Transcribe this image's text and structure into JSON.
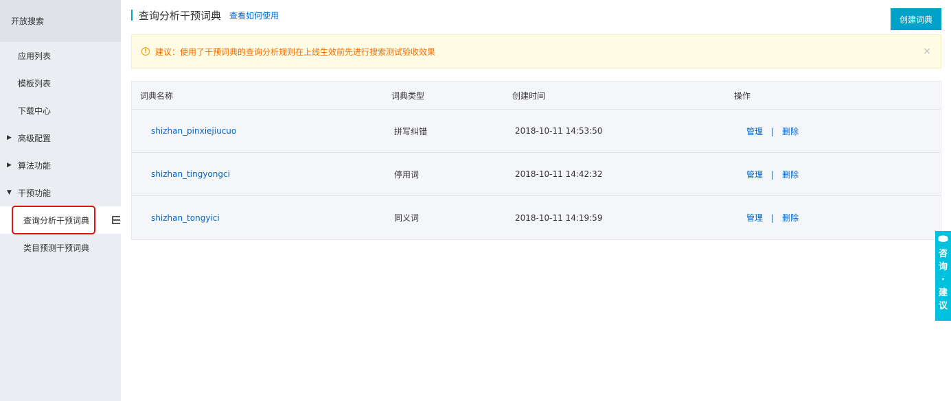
{
  "sidebar": {
    "title": "开放搜索",
    "items": [
      {
        "label": "应用列表",
        "type": "item"
      },
      {
        "label": "模板列表",
        "type": "item"
      },
      {
        "label": "下载中心",
        "type": "item"
      },
      {
        "label": "高级配置",
        "type": "group",
        "expanded": false
      },
      {
        "label": "算法功能",
        "type": "group",
        "expanded": false
      },
      {
        "label": "干预功能",
        "type": "group",
        "expanded": true
      },
      {
        "label": "查询分析干预词典",
        "type": "sub",
        "active": true
      },
      {
        "label": "类目预测干预词典",
        "type": "sub"
      }
    ]
  },
  "header": {
    "title": "查询分析干预词典",
    "help_link": "查看如何使用",
    "create_button": "创建词典"
  },
  "alert": {
    "text": "建议：使用了干预词典的查询分析规则在上线生效前先进行搜索测试验收效果",
    "close": "×"
  },
  "table": {
    "columns": [
      "词典名称",
      "词典类型",
      "创建时间",
      "操作"
    ],
    "rows": [
      {
        "name": "shizhan_pinxiejiucuo",
        "type": "拼写纠错",
        "created": "2018-10-11 14:53:50",
        "manage": "管理",
        "delete": "删除"
      },
      {
        "name": "shizhan_tingyongci",
        "type": "停用词",
        "created": "2018-10-11 14:42:32",
        "manage": "管理",
        "delete": "删除"
      },
      {
        "name": "shizhan_tongyici",
        "type": "同义词",
        "created": "2018-10-11 14:19:59",
        "manage": "管理",
        "delete": "删除"
      }
    ],
    "separator": "|"
  },
  "feedback": {
    "label": "咨询·建议"
  },
  "colors": {
    "accent": "#00a2ca",
    "link": "#0066cc",
    "alert_text": "#f36b00",
    "highlight_box": "#e0140f",
    "feedback_bg": "#00c1de"
  }
}
